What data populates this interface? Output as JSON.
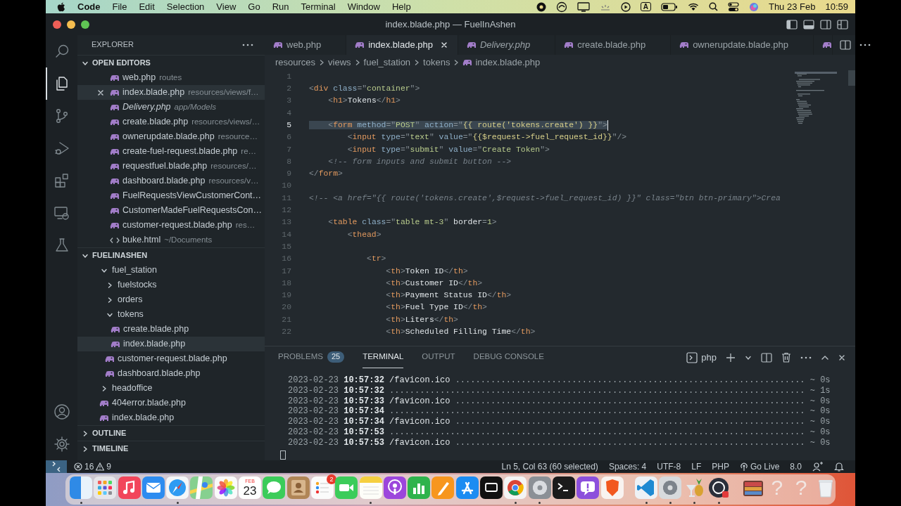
{
  "menubar": {
    "app": "Code",
    "menus": [
      "File",
      "Edit",
      "Selection",
      "View",
      "Go",
      "Run",
      "Terminal",
      "Window",
      "Help"
    ],
    "input_source": "A",
    "date": "Thu 23 Feb",
    "time": "10:59"
  },
  "window": {
    "title": "index.blade.php — FuelInAshen"
  },
  "activity_bar": {
    "items": [
      {
        "kind": "search",
        "selected": false
      },
      {
        "kind": "files",
        "selected": true
      },
      {
        "kind": "source-control",
        "selected": false
      },
      {
        "kind": "run-debug",
        "selected": false
      },
      {
        "kind": "extensions",
        "selected": false
      },
      {
        "kind": "remote",
        "selected": false
      },
      {
        "kind": "testing",
        "selected": false
      }
    ],
    "bottom": [
      {
        "kind": "account"
      },
      {
        "kind": "settings"
      }
    ]
  },
  "sidebar": {
    "title": "EXPLORER",
    "sections": [
      {
        "title": "OPEN EDITORS",
        "kind": "editors",
        "expanded": true,
        "items": [
          {
            "label": "web.php",
            "detail": "routes",
            "kind": "php",
            "selected": false,
            "preview": false
          },
          {
            "label": "index.blade.php",
            "detail": "resources/views/f…",
            "kind": "php",
            "selected": true,
            "preview": false
          },
          {
            "label": "Delivery.php",
            "detail": "app/Models",
            "kind": "php",
            "selected": false,
            "preview": true
          },
          {
            "label": "create.blade.php",
            "detail": "resources/views/…",
            "kind": "php",
            "selected": false,
            "preview": false
          },
          {
            "label": "ownerupdate.blade.php",
            "detail": "resource…",
            "kind": "php",
            "selected": false,
            "preview": false
          },
          {
            "label": "create-fuel-request.blade.php",
            "detail": "re…",
            "kind": "php",
            "selected": false,
            "preview": false
          },
          {
            "label": "requestfuel.blade.php",
            "detail": "resources/…",
            "kind": "php",
            "selected": false,
            "preview": false
          },
          {
            "label": "dashboard.blade.php",
            "detail": "resources/v…",
            "kind": "php",
            "selected": false,
            "preview": false
          },
          {
            "label": "FuelRequestsViewCustomerCont…",
            "kind": "php",
            "selected": false,
            "preview": false
          },
          {
            "label": "CustomerMadeFuelRequestsCon…",
            "kind": "php",
            "selected": false,
            "preview": false
          },
          {
            "label": "customer-request.blade.php",
            "detail": "res…",
            "kind": "php",
            "selected": false,
            "preview": false
          },
          {
            "label": "buke.html",
            "detail": "~/Documents",
            "kind": "html",
            "selected": false,
            "preview": false
          }
        ]
      },
      {
        "title": "FUELINASHEN",
        "kind": "tree",
        "expanded": true,
        "items": [
          {
            "label": "fuel_station",
            "kind": "folder",
            "expanded": true,
            "selected": false,
            "children": [
              {
                "label": "fuelstocks",
                "kind": "folder",
                "expanded": false,
                "selected": false
              },
              {
                "label": "orders",
                "kind": "folder",
                "expanded": false,
                "selected": false
              },
              {
                "label": "tokens",
                "kind": "folder",
                "expanded": true,
                "selected": false,
                "children": [
                  {
                    "label": "create.blade.php",
                    "kind": "php",
                    "selected": false
                  },
                  {
                    "label": "index.blade.php",
                    "kind": "php",
                    "selected": true
                  }
                ]
              },
              {
                "label": "customer-request.blade.php",
                "kind": "php",
                "selected": false
              },
              {
                "label": "dashboard.blade.php",
                "kind": "php",
                "selected": false
              }
            ]
          },
          {
            "label": "headoffice",
            "kind": "folder",
            "expanded": false,
            "selected": false
          },
          {
            "label": "404error.blade.php",
            "kind": "php",
            "selected": false
          },
          {
            "label": "index.blade.php",
            "kind": "php",
            "selected": false
          }
        ]
      },
      {
        "title": "OUTLINE",
        "expanded": false
      },
      {
        "title": "TIMELINE",
        "expanded": false
      }
    ]
  },
  "tabs": [
    {
      "label": "web.php",
      "kind": "php",
      "selected": false,
      "preview": false
    },
    {
      "label": "index.blade.php",
      "kind": "php",
      "selected": true,
      "preview": false
    },
    {
      "label": "Delivery.php",
      "kind": "php",
      "selected": false,
      "preview": true
    },
    {
      "label": "create.blade.php",
      "kind": "php",
      "selected": false,
      "preview": false
    },
    {
      "label": "ownerupdate.blade.php",
      "kind": "php",
      "selected": false,
      "preview": false
    }
  ],
  "breadcrumbs": [
    "resources",
    "views",
    "fuel_station",
    "tokens",
    "index.blade.php"
  ],
  "code": [
    {
      "number": "1",
      "selected": false
    },
    {
      "number": "2",
      "selected": false,
      "segments": [
        {
          "kind": "punct",
          "text": "<"
        },
        {
          "kind": "tag",
          "text": "div"
        },
        {
          "kind": "attr",
          "text": " class"
        },
        {
          "kind": "punct",
          "text": "=\""
        },
        {
          "kind": "string",
          "text": "container"
        },
        {
          "kind": "punct",
          "text": "\">"
        }
      ]
    },
    {
      "number": "3",
      "selected": false,
      "segments": [
        {
          "kind": "punct",
          "text": "    <"
        },
        {
          "kind": "tag",
          "text": "h1"
        },
        {
          "kind": "punct",
          "text": ">"
        },
        {
          "kind": "text",
          "text": "Tokens"
        },
        {
          "kind": "punct",
          "text": "</"
        },
        {
          "kind": "tag",
          "text": "h1"
        },
        {
          "kind": "punct",
          "text": ">"
        }
      ]
    },
    {
      "number": "4",
      "selected": false
    },
    {
      "number": "5",
      "selected": true,
      "segments": [
        {
          "kind": "punct",
          "text": "    <"
        },
        {
          "kind": "tag",
          "text": "form"
        },
        {
          "kind": "attr",
          "text": " method"
        },
        {
          "kind": "punct",
          "text": "=\""
        },
        {
          "kind": "string",
          "text": "POST"
        },
        {
          "kind": "punct",
          "text": "\" "
        },
        {
          "kind": "attr",
          "text": "action"
        },
        {
          "kind": "punct",
          "text": "=\""
        },
        {
          "kind": "blade",
          "text": "{{ route('tokens.create') }}"
        },
        {
          "kind": "punct",
          "text": "\">"
        }
      ]
    },
    {
      "number": "6",
      "selected": false,
      "segments": [
        {
          "kind": "punct",
          "text": "        <"
        },
        {
          "kind": "tag",
          "text": "input"
        },
        {
          "kind": "attr",
          "text": " type"
        },
        {
          "kind": "punct",
          "text": "=\""
        },
        {
          "kind": "string",
          "text": "text"
        },
        {
          "kind": "punct",
          "text": "\" "
        },
        {
          "kind": "attr",
          "text": "value"
        },
        {
          "kind": "punct",
          "text": "=\""
        },
        {
          "kind": "blade",
          "text": "{{$request->fuel_request_id}}"
        },
        {
          "kind": "punct",
          "text": "\"/>"
        }
      ]
    },
    {
      "number": "7",
      "selected": false,
      "segments": [
        {
          "kind": "punct",
          "text": "        <"
        },
        {
          "kind": "tag",
          "text": "input"
        },
        {
          "kind": "attr",
          "text": " type"
        },
        {
          "kind": "punct",
          "text": "=\""
        },
        {
          "kind": "string",
          "text": "submit"
        },
        {
          "kind": "punct",
          "text": "\" "
        },
        {
          "kind": "attr",
          "text": "value"
        },
        {
          "kind": "punct",
          "text": "=\""
        },
        {
          "kind": "string",
          "text": "Create Token"
        },
        {
          "kind": "punct",
          "text": "\">"
        }
      ]
    },
    {
      "number": "8",
      "selected": false,
      "segments": [
        {
          "kind": "comment",
          "text": "    <!-- form inputs and submit button -->"
        }
      ]
    },
    {
      "number": "9",
      "selected": false,
      "segments": [
        {
          "kind": "punct",
          "text": "</"
        },
        {
          "kind": "tag",
          "text": "form"
        },
        {
          "kind": "punct",
          "text": ">"
        }
      ]
    },
    {
      "number": "10",
      "selected": false
    },
    {
      "number": "11",
      "selected": false,
      "segments": [
        {
          "kind": "comment",
          "text": "<!-- <a href=\"{{ route('tokens.create',$request->fuel_request_id) }}\" class=\"btn btn-primary\">Crea"
        }
      ]
    },
    {
      "number": "12",
      "selected": false
    },
    {
      "number": "13",
      "selected": false,
      "segments": [
        {
          "kind": "punct",
          "text": "    <"
        },
        {
          "kind": "tag",
          "text": "table"
        },
        {
          "kind": "attr",
          "text": " class"
        },
        {
          "kind": "punct",
          "text": "=\""
        },
        {
          "kind": "string",
          "text": "table mt-3"
        },
        {
          "kind": "punct",
          "text": "\" "
        },
        {
          "kind": "text",
          "text": "border"
        },
        {
          "kind": "punct",
          "text": "="
        },
        {
          "kind": "string",
          "text": "1"
        },
        {
          "kind": "punct",
          "text": ">"
        }
      ]
    },
    {
      "number": "14",
      "selected": false,
      "segments": [
        {
          "kind": "punct",
          "text": "        <"
        },
        {
          "kind": "tag",
          "text": "thead"
        },
        {
          "kind": "punct",
          "text": ">"
        }
      ]
    },
    {
      "number": "15",
      "selected": false
    },
    {
      "number": "16",
      "selected": false,
      "segments": [
        {
          "kind": "punct",
          "text": "            <"
        },
        {
          "kind": "tag",
          "text": "tr"
        },
        {
          "kind": "punct",
          "text": ">"
        }
      ]
    },
    {
      "number": "17",
      "selected": false,
      "segments": [
        {
          "kind": "punct",
          "text": "                <"
        },
        {
          "kind": "tag",
          "text": "th"
        },
        {
          "kind": "punct",
          "text": ">"
        },
        {
          "kind": "text",
          "text": "Token ID"
        },
        {
          "kind": "punct",
          "text": "</"
        },
        {
          "kind": "tag",
          "text": "th"
        },
        {
          "kind": "punct",
          "text": ">"
        }
      ]
    },
    {
      "number": "18",
      "selected": false,
      "segments": [
        {
          "kind": "punct",
          "text": "                <"
        },
        {
          "kind": "tag",
          "text": "th"
        },
        {
          "kind": "punct",
          "text": ">"
        },
        {
          "kind": "text",
          "text": "Customer ID"
        },
        {
          "kind": "punct",
          "text": "</"
        },
        {
          "kind": "tag",
          "text": "th"
        },
        {
          "kind": "punct",
          "text": ">"
        }
      ]
    },
    {
      "number": "19",
      "selected": false,
      "segments": [
        {
          "kind": "punct",
          "text": "                <"
        },
        {
          "kind": "tag",
          "text": "th"
        },
        {
          "kind": "punct",
          "text": ">"
        },
        {
          "kind": "text",
          "text": "Payment Status ID"
        },
        {
          "kind": "punct",
          "text": "</"
        },
        {
          "kind": "tag",
          "text": "th"
        },
        {
          "kind": "punct",
          "text": ">"
        }
      ]
    },
    {
      "number": "20",
      "selected": false,
      "segments": [
        {
          "kind": "punct",
          "text": "                <"
        },
        {
          "kind": "tag",
          "text": "th"
        },
        {
          "kind": "punct",
          "text": ">"
        },
        {
          "kind": "text",
          "text": "Fuel Type ID"
        },
        {
          "kind": "punct",
          "text": "</"
        },
        {
          "kind": "tag",
          "text": "th"
        },
        {
          "kind": "punct",
          "text": ">"
        }
      ]
    },
    {
      "number": "21",
      "selected": false,
      "segments": [
        {
          "kind": "punct",
          "text": "                <"
        },
        {
          "kind": "tag",
          "text": "th"
        },
        {
          "kind": "punct",
          "text": ">"
        },
        {
          "kind": "text",
          "text": "Liters"
        },
        {
          "kind": "punct",
          "text": "</"
        },
        {
          "kind": "tag",
          "text": "th"
        },
        {
          "kind": "punct",
          "text": ">"
        }
      ]
    },
    {
      "number": "22",
      "selected": false,
      "segments": [
        {
          "kind": "punct",
          "text": "                <"
        },
        {
          "kind": "tag",
          "text": "th"
        },
        {
          "kind": "punct",
          "text": ">"
        },
        {
          "kind": "text",
          "text": "Scheduled Filling Time"
        },
        {
          "kind": "punct",
          "text": "</"
        },
        {
          "kind": "tag",
          "text": "th"
        },
        {
          "kind": "punct",
          "text": ">"
        }
      ]
    }
  ],
  "panel": {
    "tabs": [
      {
        "label": "PROBLEMS",
        "badge": "25",
        "selected": false
      },
      {
        "label": "TERMINAL",
        "selected": true
      },
      {
        "label": "OUTPUT",
        "selected": false
      },
      {
        "label": "DEBUG CONSOLE",
        "selected": false
      }
    ],
    "shell": "php",
    "lines": [
      {
        "date": "2023-02-23",
        "time": "10:57:32",
        "path": "/favicon.ico",
        "dots": ".....................................................................",
        "duration": "~ 0s"
      },
      {
        "date": "2023-02-23",
        "time": "10:57:32",
        "dots": "..................................................................................",
        "duration": "~ 1s"
      },
      {
        "date": "2023-02-23",
        "time": "10:57:33",
        "path": "/favicon.ico",
        "dots": ".....................................................................",
        "duration": "~ 0s"
      },
      {
        "date": "2023-02-23",
        "time": "10:57:34",
        "dots": "..................................................................................",
        "duration": "~ 0s"
      },
      {
        "date": "2023-02-23",
        "time": "10:57:34",
        "path": "/favicon.ico",
        "dots": ".....................................................................",
        "duration": "~ 0s"
      },
      {
        "date": "2023-02-23",
        "time": "10:57:53",
        "dots": "..................................................................................",
        "duration": "~ 0s"
      },
      {
        "date": "2023-02-23",
        "time": "10:57:53",
        "path": "/favicon.ico",
        "dots": ".....................................................................",
        "duration": "~ 0s"
      }
    ]
  },
  "status_bar": {
    "errors": "16",
    "warnings": "9",
    "items": [
      {
        "text": "Ln 5, Col 63 (60 selected)",
        "kind": "text"
      },
      {
        "text": "Spaces: 4",
        "kind": "text"
      },
      {
        "text": "UTF-8",
        "kind": "text"
      },
      {
        "text": "LF",
        "kind": "text"
      },
      {
        "text": "PHP",
        "kind": "text"
      },
      {
        "text": "Go Live",
        "kind": "live"
      },
      {
        "text": "8.0",
        "kind": "text"
      }
    ]
  },
  "dock": {
    "apps": [
      {
        "kind": "finder",
        "running": true
      },
      {
        "kind": "launchpad",
        "running": false
      },
      {
        "kind": "music",
        "running": false
      },
      {
        "kind": "mail",
        "running": false
      },
      {
        "kind": "safari",
        "running": true
      },
      {
        "kind": "maps",
        "running": false
      },
      {
        "kind": "photos",
        "running": false
      },
      {
        "kind": "calendar",
        "month": "FEB",
        "day": "23",
        "running": false
      },
      {
        "kind": "messages",
        "running": false
      },
      {
        "kind": "contacts",
        "running": false
      },
      {
        "kind": "reminders",
        "badge": "2",
        "running": false
      },
      {
        "kind": "facetime",
        "running": false
      },
      {
        "kind": "notes",
        "running": true
      },
      {
        "kind": "podcasts",
        "running": false
      },
      {
        "kind": "numbers",
        "running": false
      },
      {
        "kind": "pages",
        "running": false
      },
      {
        "kind": "appstore",
        "running": false
      },
      {
        "kind": "tv",
        "running": false
      },
      {
        "kind": "chrome",
        "running": true
      },
      {
        "kind": "settings",
        "running": true
      },
      {
        "kind": "terminal",
        "running": false
      },
      {
        "kind": "feedback",
        "running": false
      },
      {
        "kind": "brave",
        "running": false
      },
      {
        "kind": "separator"
      },
      {
        "kind": "vscode",
        "running": true
      },
      {
        "kind": "prefs",
        "running": true
      },
      {
        "kind": "pineapple",
        "running": true
      },
      {
        "kind": "obs",
        "running": true
      },
      {
        "kind": "separator"
      },
      {
        "kind": "stack",
        "running": false
      },
      {
        "kind": "missing",
        "glyph": "?",
        "running": false
      },
      {
        "kind": "missing",
        "glyph": "?",
        "running": false
      },
      {
        "kind": "trash",
        "running": false
      }
    ]
  }
}
